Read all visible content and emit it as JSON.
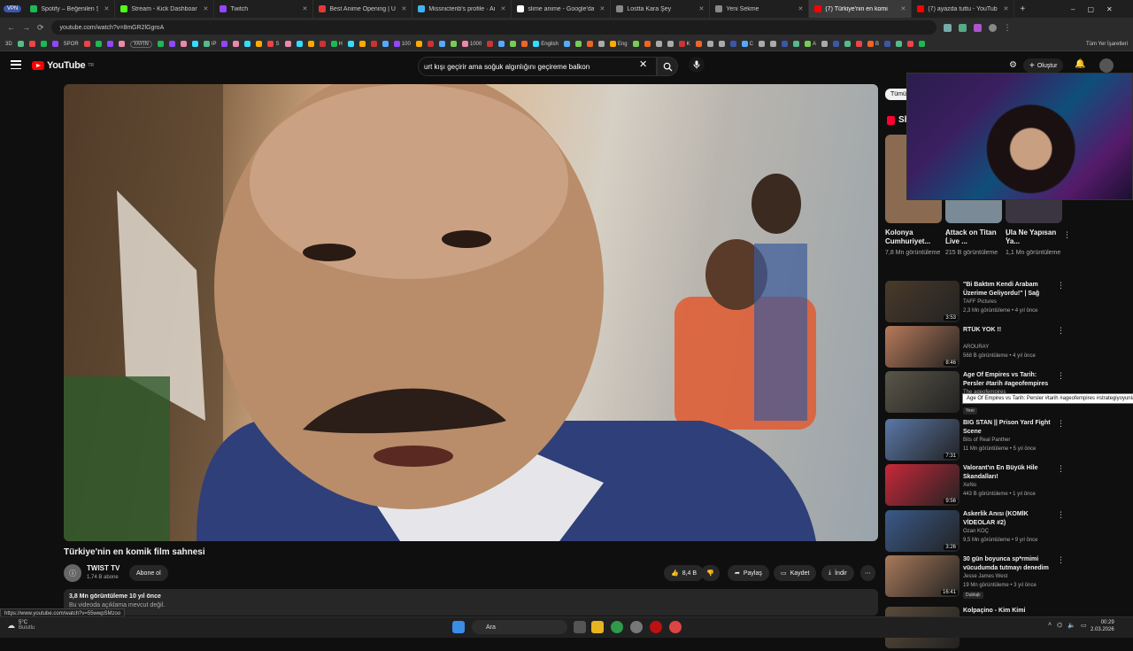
{
  "browser": {
    "tabs": [
      {
        "label": "Spotify – Beğenilen Şarkılar",
        "color": "#1db954"
      },
      {
        "label": "Stream - Kick Dashboard",
        "color": "#53fc18"
      },
      {
        "label": "Twitch",
        "color": "#9146ff"
      },
      {
        "label": "Best Anime Opening | Uwu",
        "color": "#e53935"
      },
      {
        "label": "Missnicterib's profile · AniList",
        "color": "#3db4f2"
      },
      {
        "label": "slime anime - Google'da Ara",
        "color": "#ffffff"
      },
      {
        "label": "Lostta Kara Şey",
        "color": "#888888"
      },
      {
        "label": "Yeni Sekme",
        "color": "#888888"
      },
      {
        "label": "(7) Türkiye'nin en komi",
        "color": "#ff0000"
      },
      {
        "label": "(7) ayazda tuttu - YouTube",
        "color": "#ff0000"
      }
    ],
    "vpn_badge": "VPN",
    "url": "youtube.com/watch?v=8mGR2lGgroA",
    "bookmarks": [
      "3D",
      "SPOR",
      "YAYIN",
      "IP",
      "S",
      "H",
      "100",
      "1000",
      "English",
      "Eng",
      "K",
      "C",
      "A",
      "B"
    ],
    "all_bookmarks": "Tüm Yer İşaretleri",
    "window_controls": [
      "–",
      "▢",
      "✕"
    ]
  },
  "youtube": {
    "logo_text": "YouTube",
    "logo_region": "TR",
    "search_query": "urt kışı geçirir ama soğuk algınlığını geçireme balkon",
    "create_label": "Oluştur",
    "video": {
      "title": "Türkiye'nin en komik film sahnesi",
      "channel": "TWIST TV",
      "subscribers": "1,74 B abone",
      "subscribe_label": "Abone ol",
      "likes": "8,4 B",
      "share_label": "Paylaş",
      "save_label": "Kaydet",
      "download_label": "İndir",
      "views_date": "3,8 Mn görüntüleme  10 yıl önce",
      "description": "Bu videoda açıklama mevcut değil."
    },
    "chip_label": "Tümü",
    "shorts_heading": "Shorts",
    "shorts": [
      {
        "title": "Kolonya Cumhuriyet...",
        "views": "7,8 Mn görüntüleme",
        "color": "#8a6b52"
      },
      {
        "title": "Attack on Titan Live ...",
        "views": "215 B görüntüleme",
        "color": "#7a8a96"
      },
      {
        "title": "Ula Ne Yapısan Ya...",
        "views": "1,1 Mn görüntüleme",
        "color": "#3a3540"
      }
    ],
    "recommendations": [
      {
        "title": "\"Bi Baktım Kendi Arabam Üzerime Geliyordu!\" | Sağ Sali...",
        "channel": "TAFF Pictures",
        "meta": "2,3 Mn görüntüleme • 4 yıl önce",
        "duration": "3:53",
        "color": "#4a3a2a"
      },
      {
        "title": "RTÜK YOK !!",
        "channel": "AROURAY",
        "meta": "568 B görüntüleme • 4 yıl önce",
        "duration": "8:46",
        "color": "#b87a5a"
      },
      {
        "title": "Age Of Empires vs Tarih: Persler #tarih #ageofempires ...",
        "channel": "The ageofempires",
        "meta": "1 Mn görüntüleme • 1 gün önce",
        "duration": "",
        "badge": "Yeni",
        "color": "#5a5548"
      },
      {
        "title": "BIG STAN || Prison Yard Fight Scene",
        "channel": "Bits of Real Panther",
        "meta": "11 Mn görüntüleme • 5 yıl önce",
        "duration": "7:31",
        "color": "#5a78a8"
      },
      {
        "title": "Valorant'ın En Büyük Hile Skandalları!",
        "channel": "XeNo",
        "meta": "443 B görüntüleme • 1 yıl önce",
        "duration": "9:56",
        "color": "#c8283a"
      },
      {
        "title": "Askerlik Anısı (KOMİK VİDEOLAR #2)",
        "channel": "Ozan KOÇ",
        "meta": "9,5 Mn görüntüleme • 9 yıl önce",
        "duration": "3:26",
        "color": "#3a5a8a"
      },
      {
        "title": "30 gün boyunca sp*rmimi vücudumda tutmayı denedim ...",
        "channel": "Jesse James West",
        "meta": "19 Mn görüntüleme • 3 yıl önce",
        "duration": "16:41",
        "badge": "Dublajlı",
        "color": "#a87a5a"
      },
      {
        "title": "Kolpaçino - Kim Kimi Koparıyor",
        "channel": "",
        "meta": "",
        "duration": "",
        "color": "#5a4a3a"
      }
    ],
    "tooltip": "Age Of Empires vs Tarih: Persler #tarih #ageofempires #strategiyoyunları",
    "status_url": "https://www.youtube.com/watch?v=55wwpSMzoo"
  },
  "taskbar": {
    "weather_temp": "5°C",
    "weather_desc": "Bulutlu",
    "search_placeholder": "Ara",
    "time": "00:29",
    "date": "2.03.2026"
  }
}
